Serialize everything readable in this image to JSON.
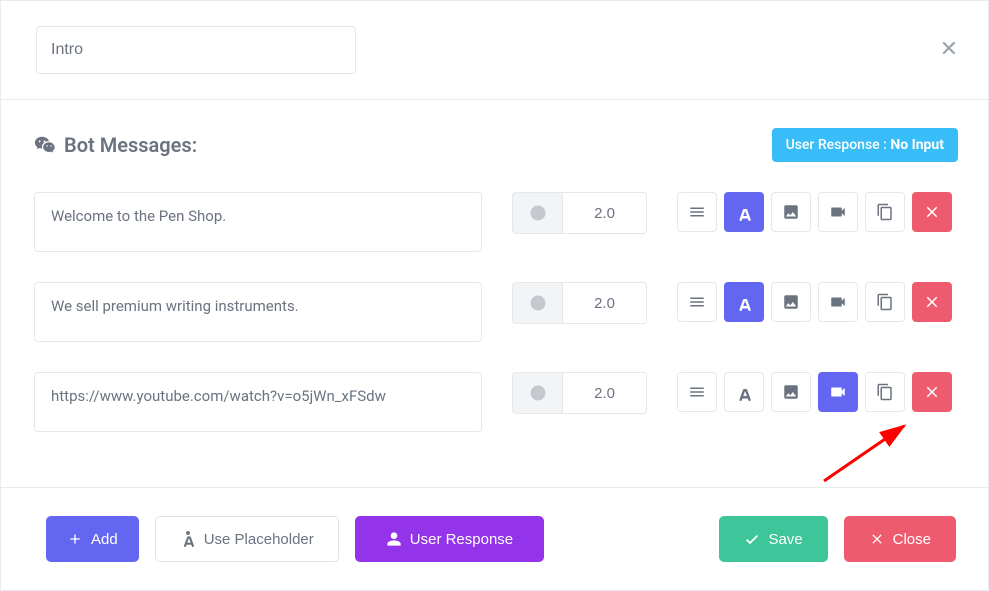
{
  "header": {
    "name_value": "Intro"
  },
  "section": {
    "title": "Bot Messages:",
    "badge_prefix": "User Response :",
    "badge_value": "No Input"
  },
  "messages": [
    {
      "text": "Welcome to the Pen Shop.",
      "delay": "2.0",
      "active_type": "text"
    },
    {
      "text": "We sell premium writing instruments.",
      "delay": "2.0",
      "active_type": "text"
    },
    {
      "text": "https://www.youtube.com/watch?v=o5jWn_xFSdw",
      "delay": "2.0",
      "active_type": "video"
    }
  ],
  "footer": {
    "add": "Add",
    "placeholder": "Use Placeholder",
    "user_response": "User Response",
    "save": "Save",
    "close": "Close"
  }
}
